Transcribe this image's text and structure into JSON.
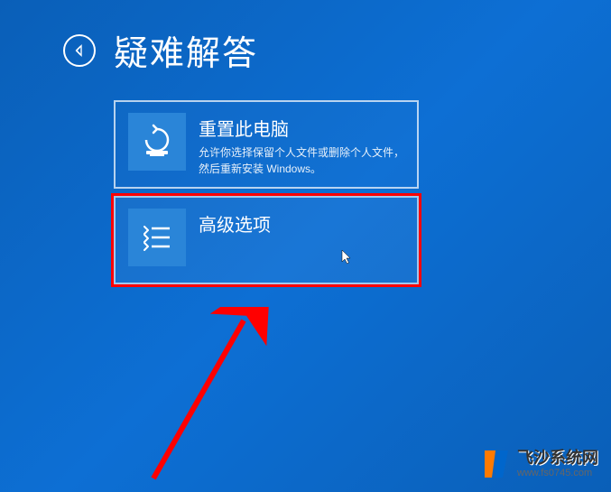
{
  "header": {
    "title": "疑难解答"
  },
  "options": {
    "reset": {
      "title": "重置此电脑",
      "description": "允许你选择保留个人文件或删除个人文件，然后重新安装 Windows。"
    },
    "advanced": {
      "title": "高级选项"
    }
  },
  "icons": {
    "back": "back-arrow-icon",
    "reset": "reset-pc-icon",
    "advanced": "list-options-icon"
  },
  "watermark": {
    "name": "飞沙系统网",
    "url": "www.fs0745.com"
  },
  "annotation": {
    "highlight_color": "#ff0000",
    "arrow_color": "#ff0000"
  }
}
